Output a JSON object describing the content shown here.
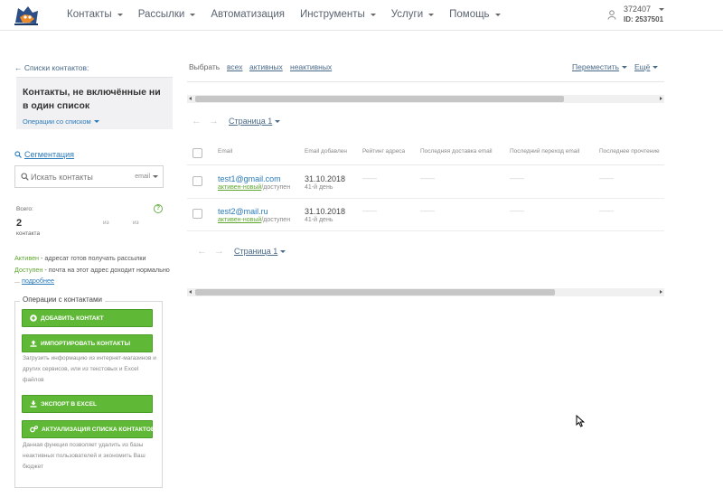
{
  "header": {
    "nav": [
      {
        "label": "Контакты",
        "caret": true
      },
      {
        "label": "Рассылки",
        "caret": true
      },
      {
        "label": "Автоматизация",
        "caret": false
      },
      {
        "label": "Инструменты",
        "caret": true
      },
      {
        "label": "Услуги",
        "caret": true
      },
      {
        "label": "Помощь",
        "caret": true
      }
    ],
    "user": {
      "login": "372407",
      "id": "ID: 2537501"
    }
  },
  "sidebar": {
    "back_link": "← Списки контактов:",
    "list_title": "Контакты, не включённые ни в один список",
    "list_ops": "Операции со списком",
    "segmentation": "Сегментация",
    "search": {
      "placeholder": "Искать контакты",
      "field": "email"
    },
    "stats": {
      "label": "Всего:",
      "count": "2",
      "of1": "из",
      "of2": "из",
      "unit": "контакта"
    },
    "legend": {
      "active_word": "Активен",
      "active_text": " - адресат готов получать рассылки",
      "available_word": "Доступен",
      "available_text": " - почта на этот адрес доходит нормально ... ",
      "more": "подробнее"
    },
    "ops": {
      "title": "Операции с контактами",
      "add": "Добавить контакт",
      "import": "Импортировать контакты",
      "import_hint": "Загрузить информацию из интернет-магазинов и других сервисов, или из текстовых и Excel файлов",
      "excel": "Экспорт в Excel",
      "actualize": "Актуализация списка контактов",
      "actualize_hint": "Данная функция позволяет удалить из базы неактивных пользователей и экономить Ваш бюджет"
    }
  },
  "toolbar": {
    "select_label": "Выбрать",
    "all": "всех",
    "active": "активных",
    "inactive": "неактивных",
    "move": "Переместить",
    "more": "Ещё"
  },
  "pager": {
    "prev": "←",
    "next": "→",
    "page": "Страница 1"
  },
  "table": {
    "headers": {
      "email": "Email",
      "added": "Email добавлен",
      "rating": "Рейтинг адреса",
      "last_delivery": "Последняя доставка email",
      "last_click": "Последний переход email",
      "last_read": "Последнее прочтение"
    },
    "rows": [
      {
        "email": "test1@gmail.com",
        "status_green": "активен-новый",
        "status_rest": "/доступен",
        "date": "31.10.2018",
        "days": "41-й день",
        "dash": "——"
      },
      {
        "email": "test2@mail.ru",
        "status_green": "активен-новый",
        "status_rest": "/доступен",
        "date": "31.10.2018",
        "days": "41-й день",
        "dash": "——"
      }
    ]
  },
  "colors": {
    "accent_green": "#5fb836",
    "link_blue": "#2a7ab8"
  },
  "icons": [
    "logo-mascot-icon",
    "user-icon",
    "search-icon",
    "help-icon",
    "plus-circle-icon",
    "upload-icon",
    "download-icon",
    "gears-icon",
    "cursor-icon"
  ]
}
